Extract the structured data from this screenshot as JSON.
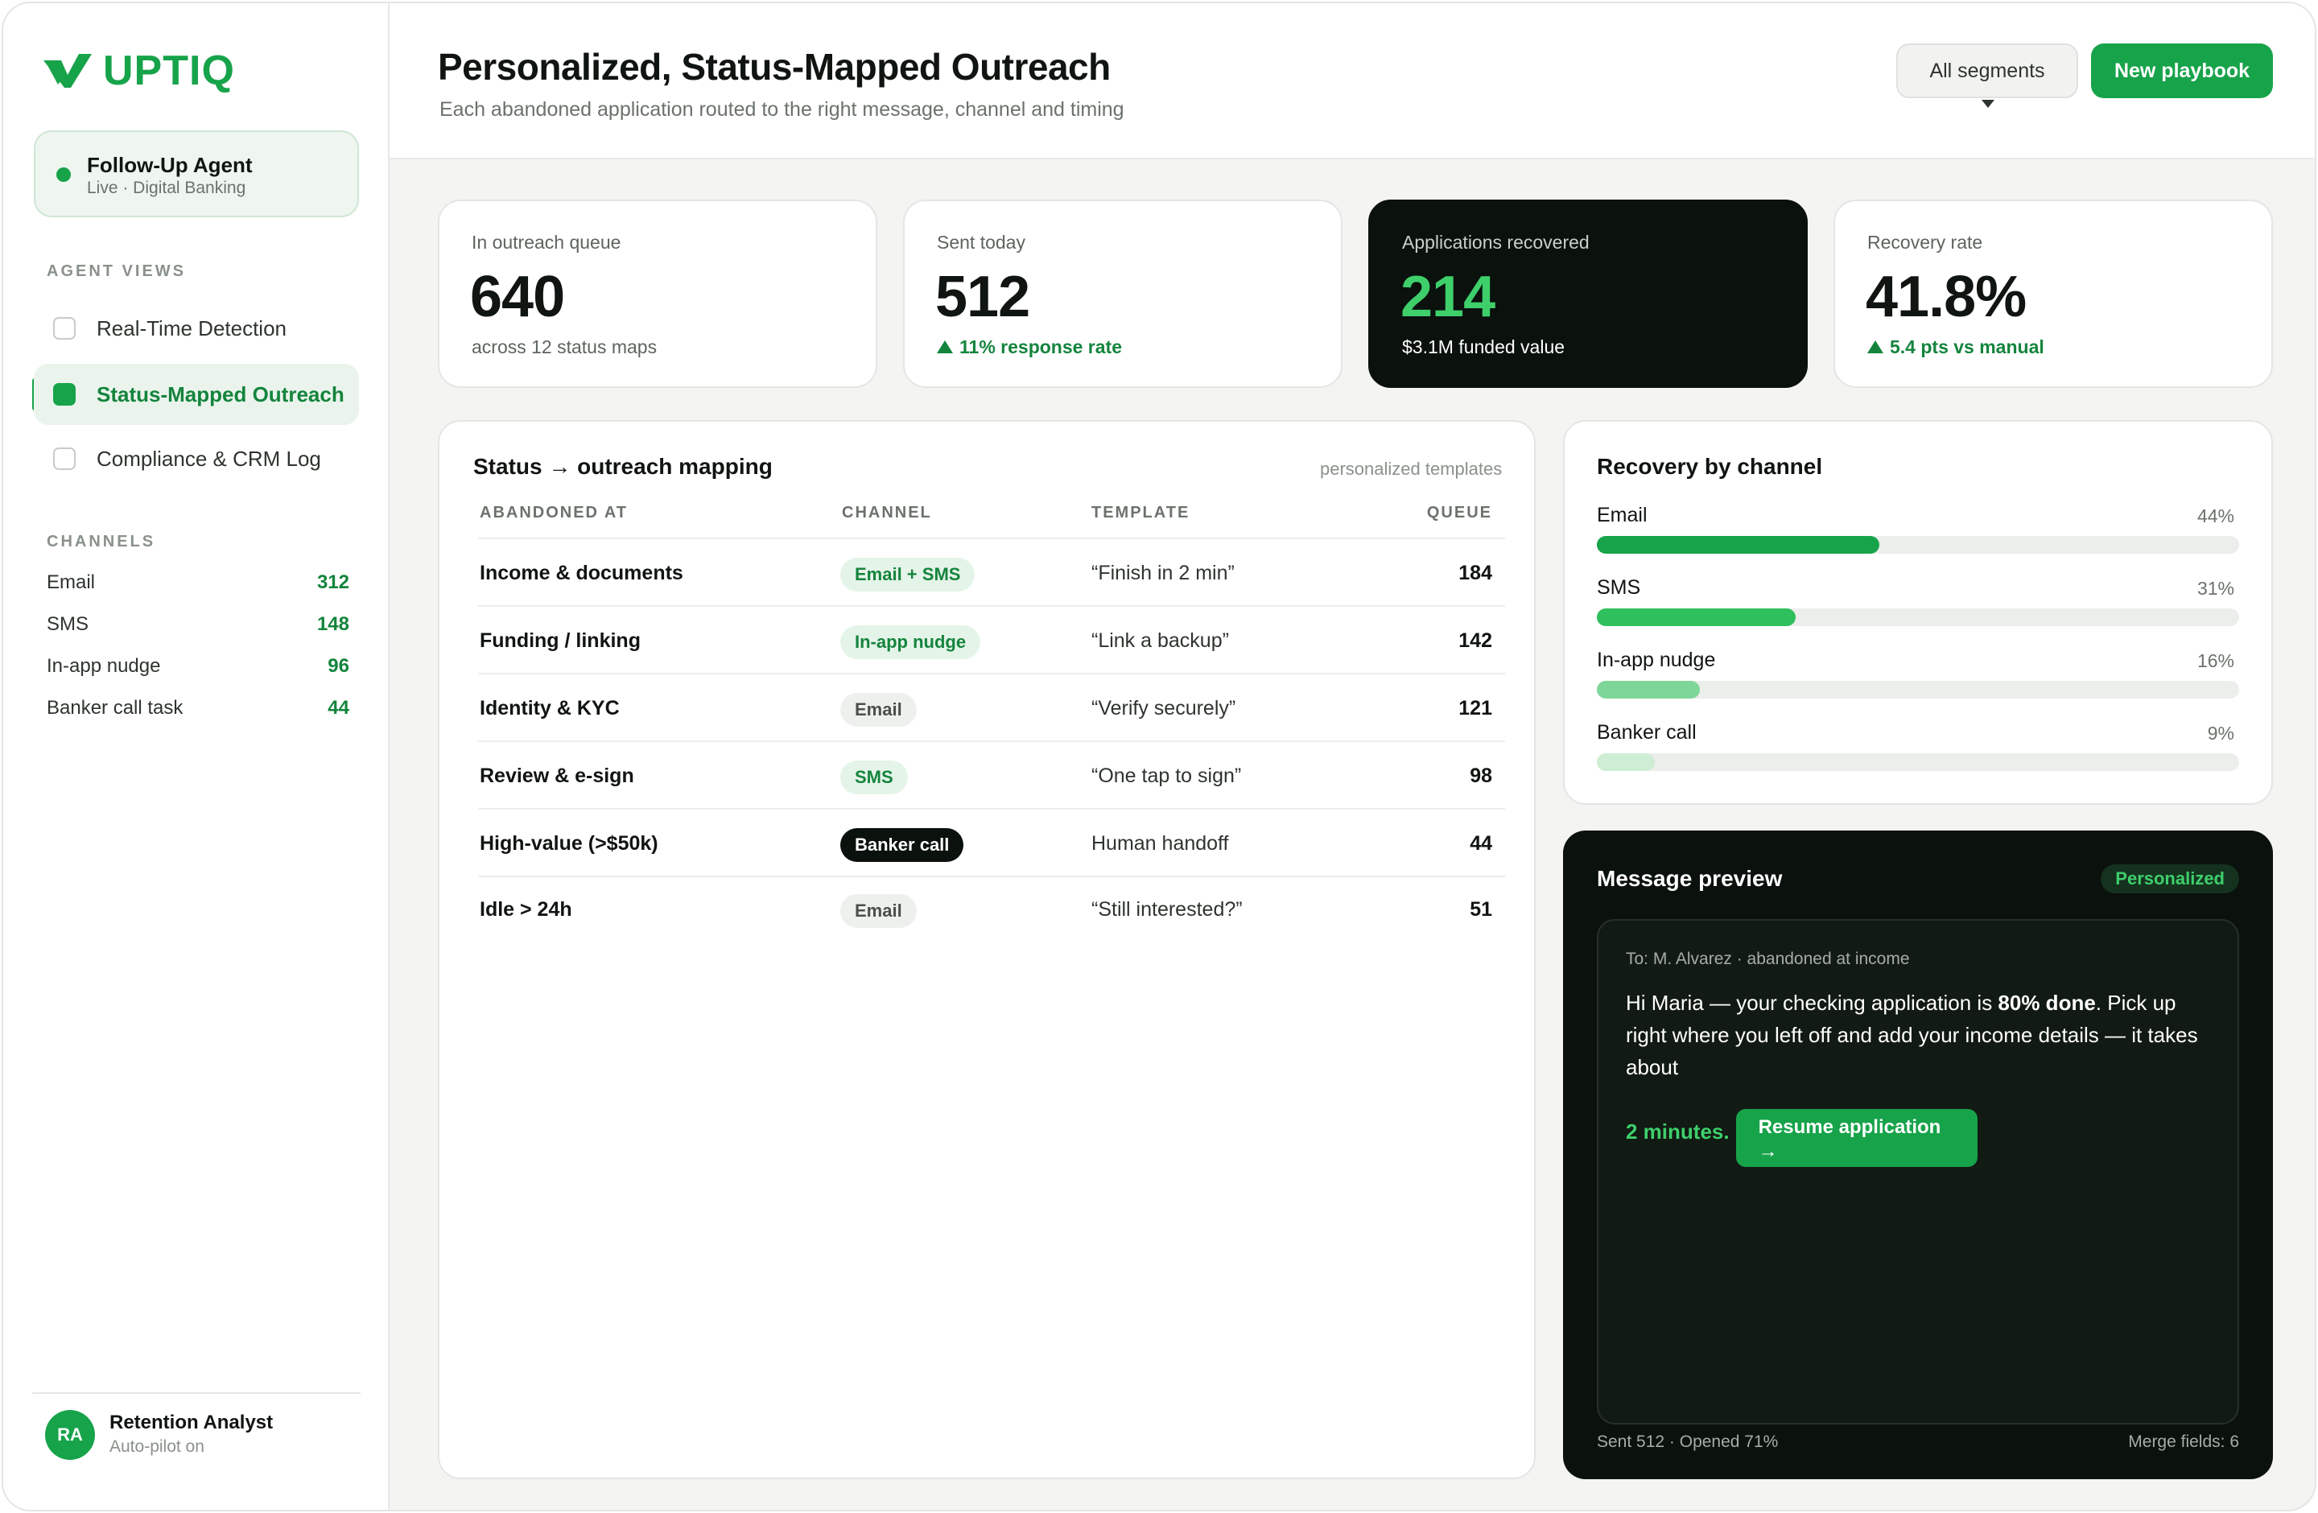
{
  "brand": {
    "name": "UPTIQ",
    "color": "#17a34a"
  },
  "agent": {
    "name": "Follow-Up Agent",
    "status": "Live · Digital Banking"
  },
  "agent_views": {
    "label": "AGENT VIEWS",
    "items": [
      {
        "label": "Real-Time Detection",
        "active": false
      },
      {
        "label": "Status-Mapped Outreach",
        "active": true
      },
      {
        "label": "Compliance & CRM Log",
        "active": false
      }
    ]
  },
  "channels": {
    "label": "CHANNELS",
    "items": [
      {
        "name": "Email",
        "count": "312"
      },
      {
        "name": "SMS",
        "count": "148"
      },
      {
        "name": "In-app nudge",
        "count": "96"
      },
      {
        "name": "Banker call task",
        "count": "44"
      }
    ]
  },
  "user": {
    "initials": "RA",
    "name": "Retention Analyst",
    "status": "Auto-pilot on"
  },
  "header": {
    "title": "Personalized, Status-Mapped Outreach",
    "subtitle": "Each abandoned application routed to the right message, channel and timing",
    "segments_button": "All segments",
    "new_button": "New playbook"
  },
  "kpis": [
    {
      "label": "In outreach queue",
      "value": "640",
      "sub": "across 12 status maps",
      "trend": false
    },
    {
      "label": "Sent today",
      "value": "512",
      "sub": "11% response rate",
      "trend": true
    },
    {
      "label": "Applications recovered",
      "value": "214",
      "sub": "$3.1M funded value",
      "trend": false
    },
    {
      "label": "Recovery rate",
      "value": "41.8%",
      "sub": "5.4 pts vs manual",
      "trend": true
    }
  ],
  "mapping": {
    "title": "Status → outreach mapping",
    "note": "personalized templates",
    "columns": [
      "ABANDONED AT",
      "CHANNEL",
      "TEMPLATE",
      "QUEUE"
    ],
    "rows": [
      {
        "stage": "Income & documents",
        "channel": "Email + SMS",
        "style": "green",
        "template": "“Finish in 2 min”",
        "queue": "184"
      },
      {
        "stage": "Funding / linking",
        "channel": "In-app nudge",
        "style": "green",
        "template": "“Link a backup”",
        "queue": "142"
      },
      {
        "stage": "Identity & KYC",
        "channel": "Email",
        "style": "gray",
        "template": "“Verify securely”",
        "queue": "121"
      },
      {
        "stage": "Review & e-sign",
        "channel": "SMS",
        "style": "green",
        "template": "“One tap to sign”",
        "queue": "98"
      },
      {
        "stage": "High-value (>$50k)",
        "channel": "Banker call",
        "style": "dark",
        "template": "Human handoff",
        "queue": "44"
      },
      {
        "stage": "Idle > 24h",
        "channel": "Email",
        "style": "gray",
        "template": "“Still interested?”",
        "queue": "51"
      }
    ]
  },
  "recovery": {
    "title": "Recovery by channel",
    "items": [
      {
        "name": "Email",
        "pct": "44%",
        "value": 44,
        "color": "#17a34a"
      },
      {
        "name": "SMS",
        "pct": "31%",
        "value": 31,
        "color": "#2fbf5c"
      },
      {
        "name": "In-app nudge",
        "pct": "16%",
        "value": 16,
        "color": "#7fd699"
      },
      {
        "name": "Banker call",
        "pct": "9%",
        "value": 9,
        "color": "#cdeed5"
      }
    ]
  },
  "preview": {
    "title": "Message preview",
    "badge": "Personalized",
    "to": "To: M. Alvarez · abandoned at income",
    "body_1": "Hi Maria — your checking application is ",
    "body_bold": "80% done",
    "body_2": ". Pick up right where you left off and add your income details — it takes about ",
    "body_green": "2 minutes.",
    "cta": "Resume application",
    "cta_arrow": "→",
    "footer_left": "Sent 512 · Opened 71%",
    "footer_right": "Merge fields: 6"
  }
}
